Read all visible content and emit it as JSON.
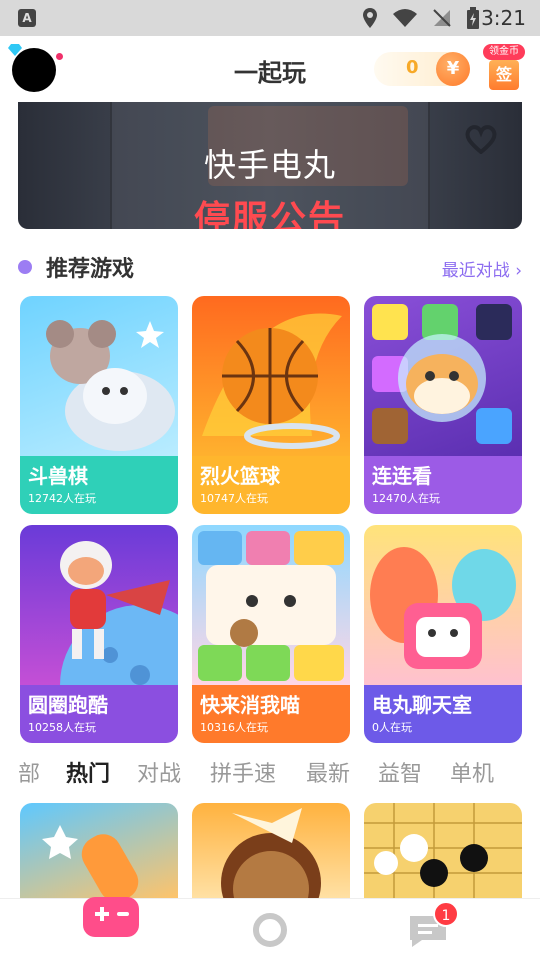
{
  "status_bar": {
    "time": "3:21",
    "app_icon_letter": "A"
  },
  "header": {
    "title": "一起玩",
    "coins": "0",
    "coin_symbol": "¥",
    "sign_tag": "领金币",
    "sign_label": "签"
  },
  "banner": {
    "brand": "快手电丸",
    "notice": "停服公告"
  },
  "section": {
    "title": "推荐游戏",
    "link": "最近对战 ›"
  },
  "games": [
    {
      "name": "斗兽棋",
      "players": "12742人在玩",
      "info_color": "#2fd0b8"
    },
    {
      "name": "烈火篮球",
      "players": "10747人在玩",
      "info_color": "#ffb62d"
    },
    {
      "name": "连连看",
      "players": "12470人在玩",
      "info_color": "#9c5be6"
    },
    {
      "name": "圆圈跑酷",
      "players": "10258人在玩",
      "info_color": "#8b4fe0"
    },
    {
      "name": "快来消我喵",
      "players": "10316人在玩",
      "info_color": "#ff7a2b"
    },
    {
      "name": "电丸聊天室",
      "players": "0人在玩",
      "info_color": "#6d5ae8"
    }
  ],
  "tabs": [
    {
      "label": "部",
      "active": false
    },
    {
      "label": "热门",
      "active": true
    },
    {
      "label": "对战",
      "active": false
    },
    {
      "label": "拼手速",
      "active": false
    },
    {
      "label": "最新",
      "active": false
    },
    {
      "label": "益智",
      "active": false
    },
    {
      "label": "单机",
      "active": false
    }
  ],
  "bottom_nav": {
    "messages_badge": "1"
  },
  "colors": {
    "accent_purple": "#8c6cf0",
    "brand_pink": "#ff4d8a",
    "badge_red": "#ff3b43"
  }
}
